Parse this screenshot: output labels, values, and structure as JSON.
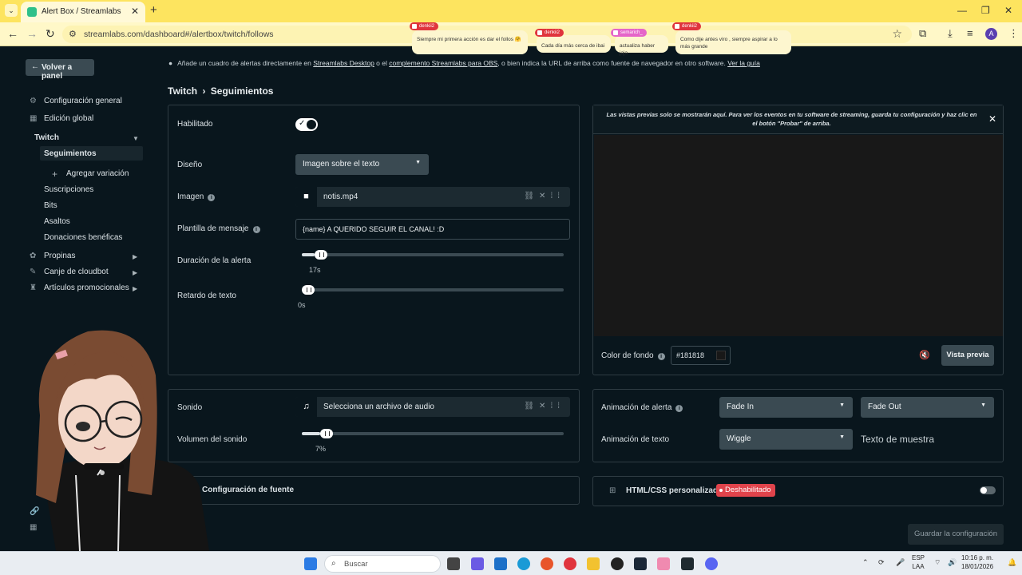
{
  "browser": {
    "tab_title": "Alert Box / Streamlabs",
    "url": "streamlabs.com/dashboard#/alertbox/twitch/follows",
    "profile_initial": "A"
  },
  "chat": [
    {
      "name": "denkii2",
      "text": "Siempre mi primera acción es dar el follos 🤗"
    },
    {
      "name": "denkii2",
      "text": "Cada día más cerca de ibai"
    },
    {
      "name": "semarich_",
      "text": "actualiza haber jaja"
    },
    {
      "name": "denkii2",
      "text": "Como dije antes viro , siempre aspirar a lo más grande"
    }
  ],
  "notice": {
    "before": "Añade un cuadro de alertas directamente en ",
    "link1": "Streamlabs Desktop",
    "mid1": " o el ",
    "link2": "complemento Streamlabs para OBS",
    "mid2": ", o bien indica la URL de arriba como fuente de navegador en otro software. ",
    "link3": "Ver la guía"
  },
  "sidebar": {
    "back_label": "Volver a panel",
    "general": "Configuración general",
    "global": "Edición global",
    "twitch": "Twitch",
    "follows": "Seguimientos",
    "add_variation": "Agregar variación",
    "subs": "Suscripciones",
    "bits": "Bits",
    "raids": "Asaltos",
    "charity": "Donaciones benéficas",
    "tips": "Propinas",
    "cloudbot": "Canje de cloudbot",
    "merch": "Artículos promocionales"
  },
  "breadcrumb": {
    "parent": "Twitch",
    "sep": "›",
    "current": "Seguimientos"
  },
  "settings": {
    "enabled_label": "Habilitado",
    "layout_label": "Diseño",
    "layout_value": "Imagen sobre el texto",
    "image_label": "Imagen",
    "image_file": "notis.mp4",
    "message_label": "Plantilla de mensaje",
    "message_value": "{name} A QUERIDO SEGUIR EL CANAL! :D",
    "duration_label": "Duración de la alerta",
    "duration_value": "17s",
    "duration_fraction": 0.05,
    "delay_label": "Retardo de texto",
    "delay_value": "0s",
    "delay_fraction": 0.0
  },
  "preview": {
    "note": "Las vistas previas solo se mostrarán aquí. Para ver los eventos en tu software de streaming, guarda tu configuración y haz clic en el botón \"Probar\" de arriba.",
    "bg_label": "Color de fondo",
    "bg_value": "#181818",
    "preview_button": "Vista previa"
  },
  "sound": {
    "sound_label": "Sonido",
    "sound_file": "Selecciona un archivo de audio",
    "volume_label": "Volumen del sonido",
    "volume_value": "7%",
    "volume_fraction": 0.07
  },
  "animation": {
    "alert_label": "Animación de alerta",
    "in_value": "Fade In",
    "out_value": "Fade Out",
    "text_label": "Animación de texto",
    "text_value": "Wiggle",
    "sample_text": "Texto de muestra"
  },
  "font_section": "Configuración de fuente",
  "custom_html": {
    "label": "HTML/CSS personalizado",
    "status": "Deshabilitado"
  },
  "save_button": "Guardar la configuración",
  "taskbar": {
    "search": "Buscar",
    "lang1": "ESP",
    "lang2": "LAA",
    "time": "10:16 p. m.",
    "date": "18/01/2026"
  },
  "colors": {
    "accent": "#e0343d",
    "bg": "#09161d",
    "chrome": "#fde45f"
  }
}
